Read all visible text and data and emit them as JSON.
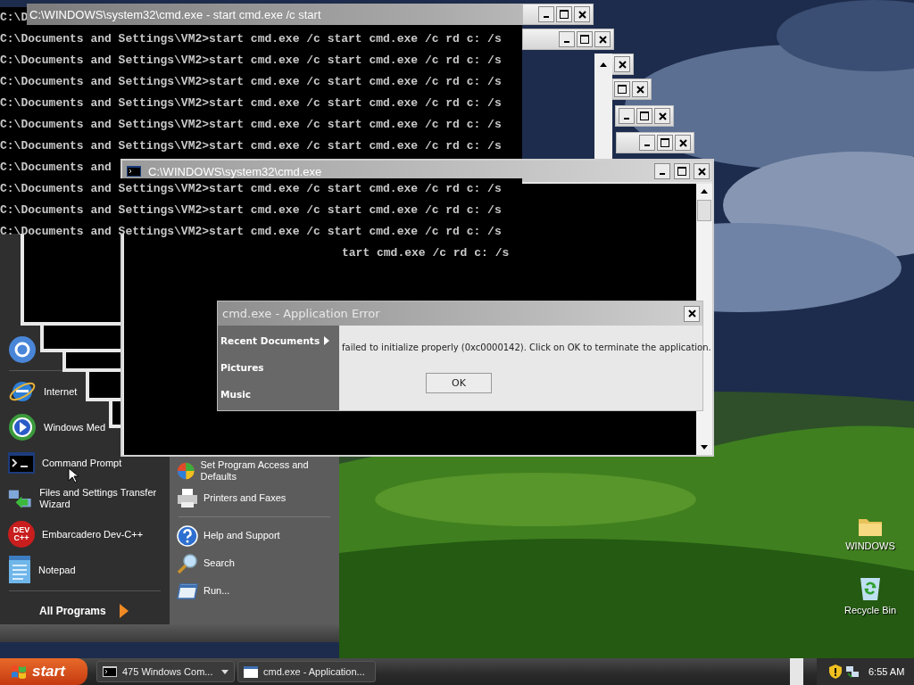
{
  "back_console": {
    "title": "C:\\WINDOWS\\system32\\cmd.exe - start cmd.exe /c start",
    "lines": [
      "C:\\D",
      "C:\\Documents and Settings\\VM2>start cmd.exe /c start cmd.exe /c rd c: /s",
      "C:\\Documents and Settings\\VM2>start cmd.exe /c start cmd.exe /c rd c: /s",
      "C:\\Documents and Settings\\VM2>start cmd.exe /c start cmd.exe /c rd c: /s",
      "C:\\Documents and Settings\\VM2>start cmd.exe /c start cmd.exe /c rd c: /s",
      "C:\\Documents and Settings\\VM2>start cmd.exe /c start cmd.exe /c rd c: /s",
      "C:\\Documents and Settings\\VM2>start cmd.exe /c start cmd.exe /c rd c: /s",
      "C:\\Documents and",
      "C:\\Documents and Settings\\VM2>start cmd.exe /c start cmd.exe /c rd c: /s",
      "C:\\Documents and Settings\\VM2>start cmd.exe /c start cmd.exe /c rd c: /s",
      "C:\\Documents and Settings\\VM2>start cmd.exe /c start cmd.exe /c rd c: /s"
    ]
  },
  "front_console": {
    "title": "C:\\WINDOWS\\system32\\cmd.exe",
    "lines": [
      "tart cmd.exe /c rd c: /s"
    ]
  },
  "start_menu": {
    "programs": [
      {
        "kind": "ring"
      },
      {
        "kind": "browser",
        "label": "Internet"
      },
      {
        "kind": "media",
        "label": "Windows Med"
      },
      {
        "kind": "console",
        "label": "Command Prompt"
      },
      {
        "kind": "transfer",
        "label": "Files and Settings Transfer Wizard"
      },
      {
        "kind": "devcpp",
        "label": "Embarcadero Dev-C++",
        "icon_text": "DEV C++"
      },
      {
        "kind": "notepad",
        "label": "Notepad"
      }
    ],
    "all_programs": "All Programs",
    "places": [
      {
        "kind": "access",
        "label": "Set Program Access and Defaults"
      },
      {
        "kind": "printer",
        "label": "Printers and Faxes"
      },
      {
        "kind": "help",
        "label": "Help and Support"
      },
      {
        "kind": "search",
        "label": "Search"
      },
      {
        "kind": "run",
        "label": "Run..."
      }
    ]
  },
  "error_dialog": {
    "title": "cmd.exe - Application Error",
    "menu_items": [
      {
        "label": "Recent Documents",
        "submenu": true
      },
      {
        "label": "Pictures",
        "submenu": false
      },
      {
        "label": "Music",
        "submenu": false
      }
    ],
    "message": "failed to initialize properly (0xc0000142). Click on OK to terminate the application.",
    "button": "OK"
  },
  "desktop_icons": [
    {
      "kind": "folder",
      "label": "WINDOWS"
    },
    {
      "kind": "recycle",
      "label": "Recycle Bin"
    }
  ],
  "taskbar": {
    "start": "start",
    "buttons": [
      {
        "label": "475 Windows Com...",
        "kind": "console",
        "grouped": true
      },
      {
        "label": "cmd.exe - Application...",
        "kind": "window",
        "grouped": false
      }
    ],
    "clock": "6:55 AM"
  }
}
